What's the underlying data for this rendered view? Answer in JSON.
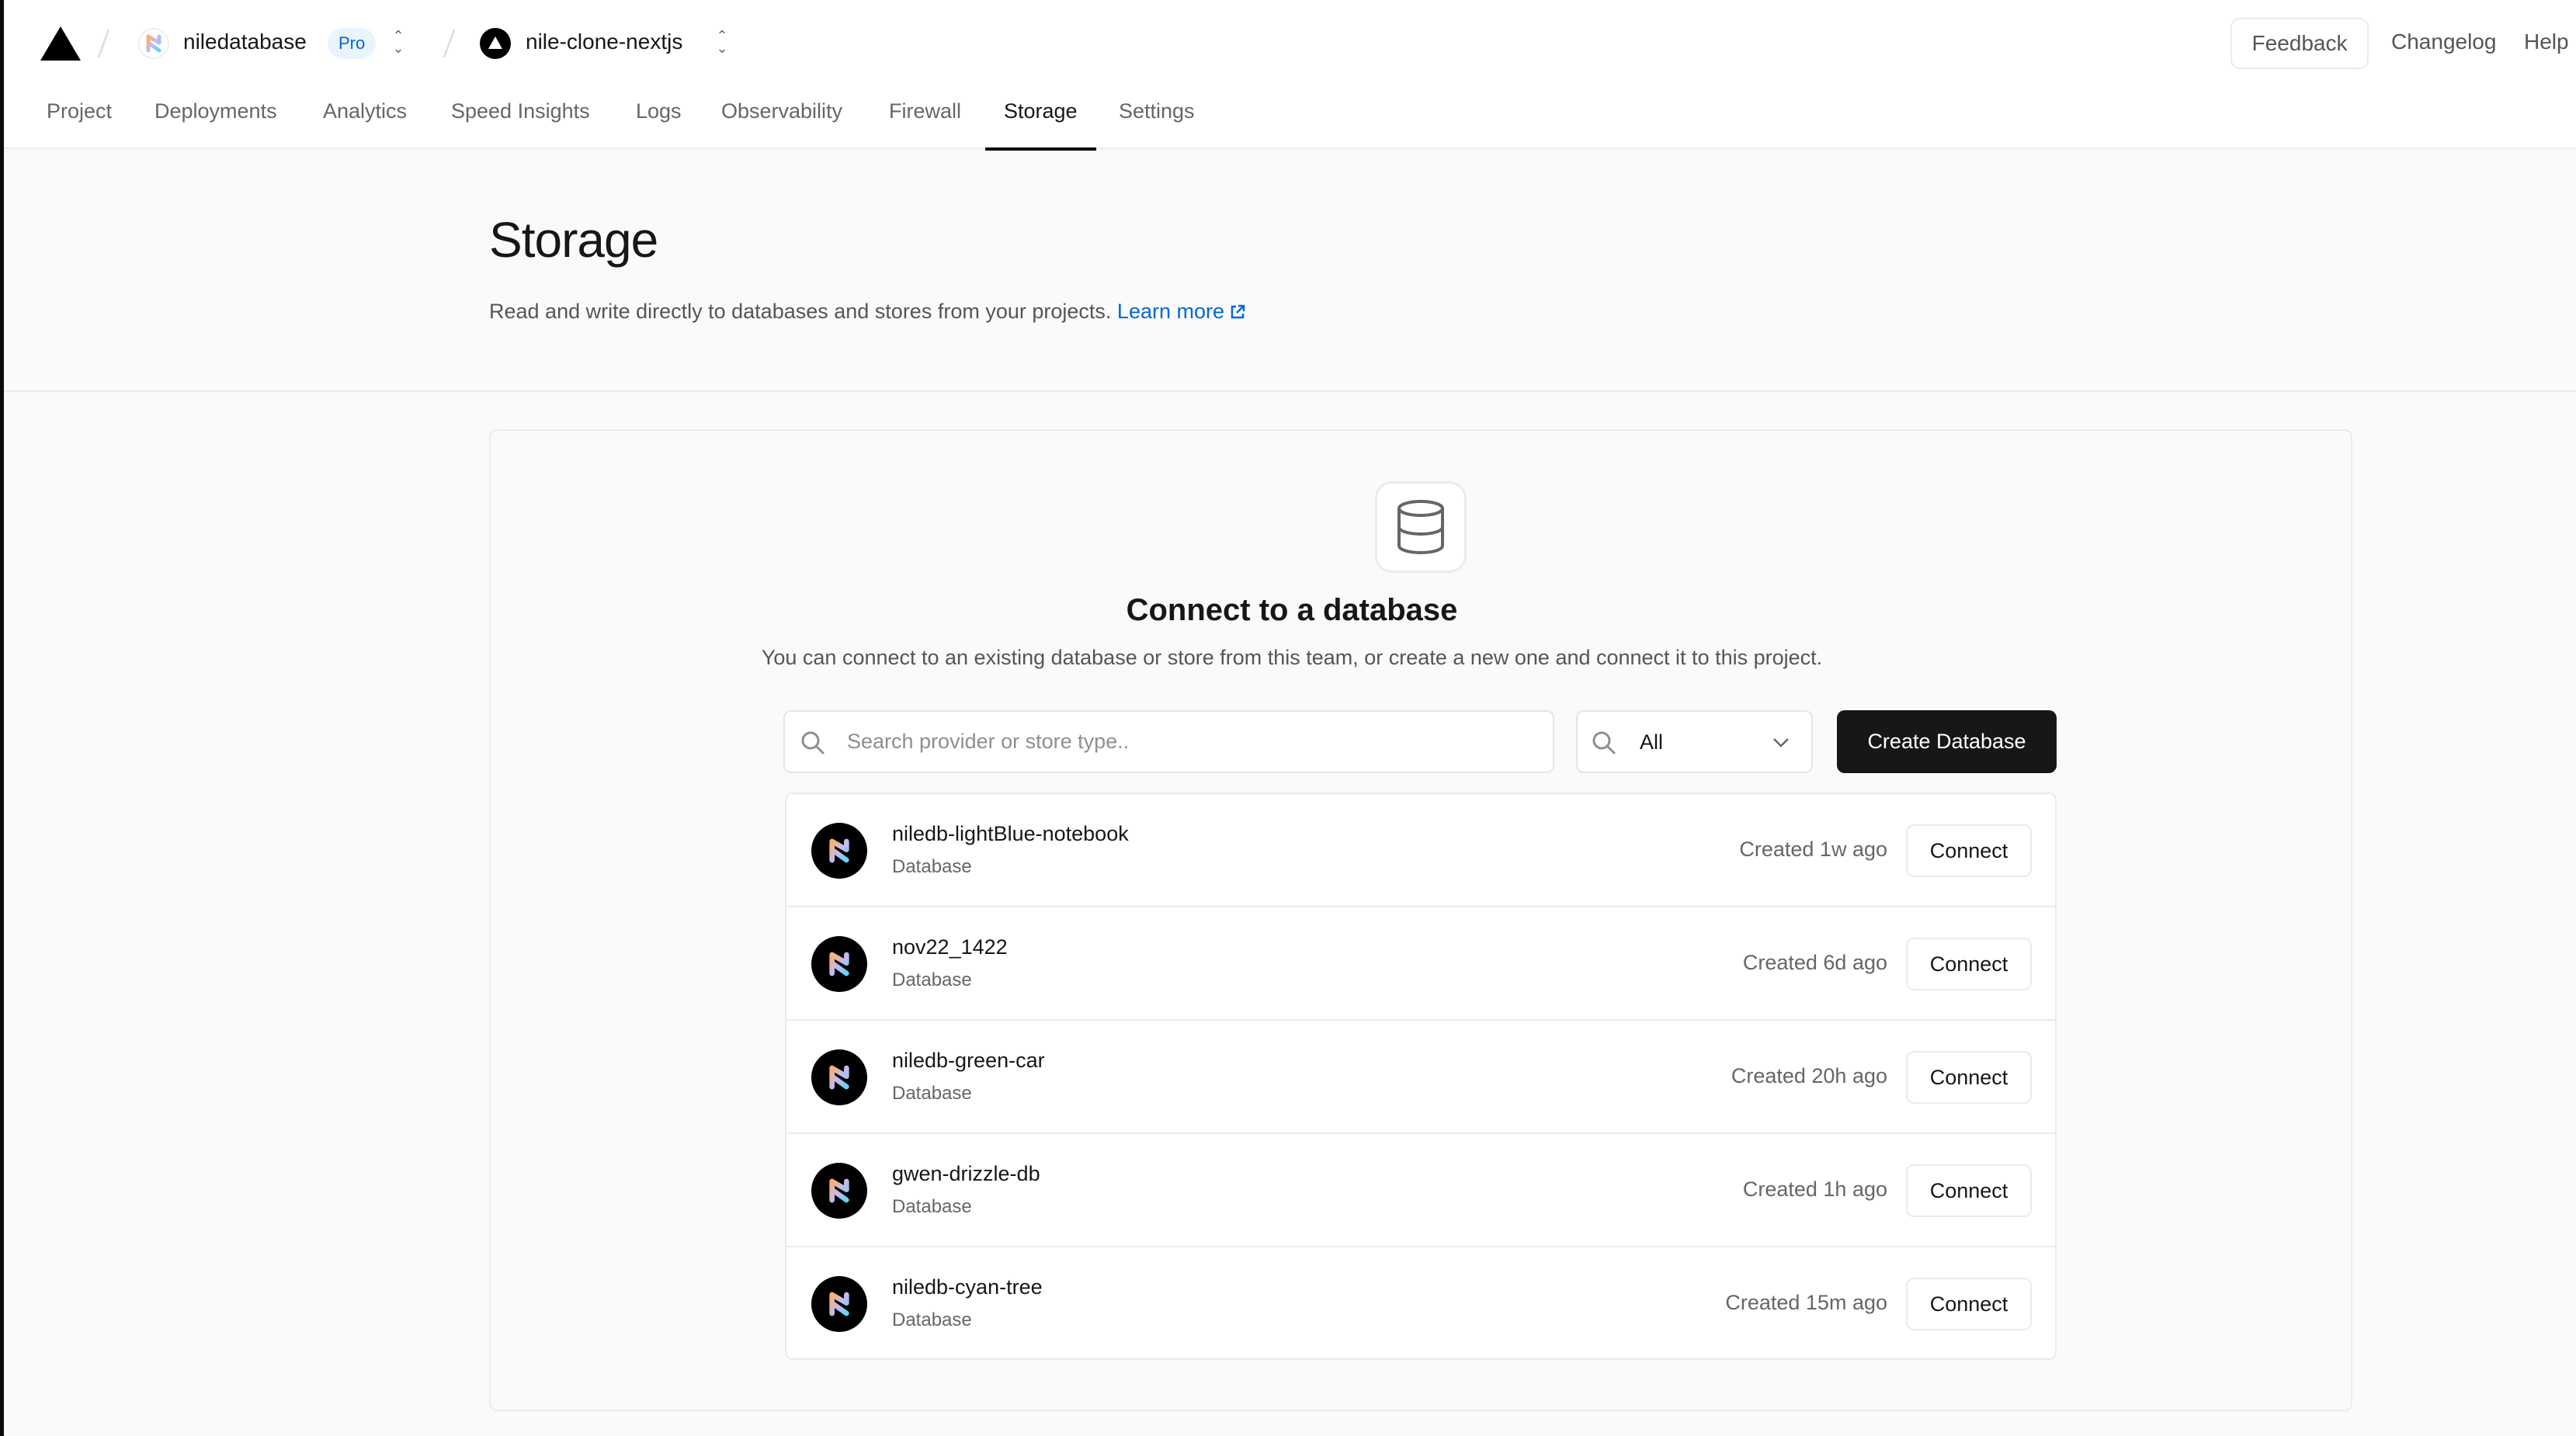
{
  "header": {
    "team": {
      "name": "niledatabase",
      "plan_badge": "Pro"
    },
    "project": {
      "name": "nile-clone-nextjs"
    },
    "actions": {
      "feedback": "Feedback",
      "changelog": "Changelog",
      "help": "Help"
    },
    "tabs": [
      {
        "label": "Project",
        "active": false
      },
      {
        "label": "Deployments",
        "active": false
      },
      {
        "label": "Analytics",
        "active": false
      },
      {
        "label": "Speed Insights",
        "active": false
      },
      {
        "label": "Logs",
        "active": false
      },
      {
        "label": "Observability",
        "active": false
      },
      {
        "label": "Firewall",
        "active": false
      },
      {
        "label": "Storage",
        "active": true
      },
      {
        "label": "Settings",
        "active": false
      }
    ]
  },
  "page": {
    "title": "Storage",
    "description": "Read and write directly to databases and stores from your projects.",
    "learn_more": "Learn more"
  },
  "connect": {
    "icon": "database-icon",
    "title": "Connect to a database",
    "subtitle": "You can connect to an existing database or store from this team, or create a new one and connect it to this project.",
    "search": {
      "placeholder": "Search provider or store type..",
      "value": ""
    },
    "filter": {
      "selected": "All"
    },
    "create_label": "Create Database",
    "connect_label": "Connect",
    "databases": [
      {
        "name": "niledb-lightBlue-notebook",
        "type": "Database",
        "created": "Created 1w ago"
      },
      {
        "name": "nov22_1422",
        "type": "Database",
        "created": "Created 6d ago"
      },
      {
        "name": "niledb-green-car",
        "type": "Database",
        "created": "Created 20h ago"
      },
      {
        "name": "gwen-drizzle-db",
        "type": "Database",
        "created": "Created 1h ago"
      },
      {
        "name": "niledb-cyan-tree",
        "type": "Database",
        "created": "Created 15m ago"
      }
    ]
  },
  "colors": {
    "accent_link": "#0068d6",
    "badge_bg": "#e9f4ff",
    "primary_button": "#171717",
    "page_bg": "#fafafa",
    "border": "#ebebeb"
  }
}
